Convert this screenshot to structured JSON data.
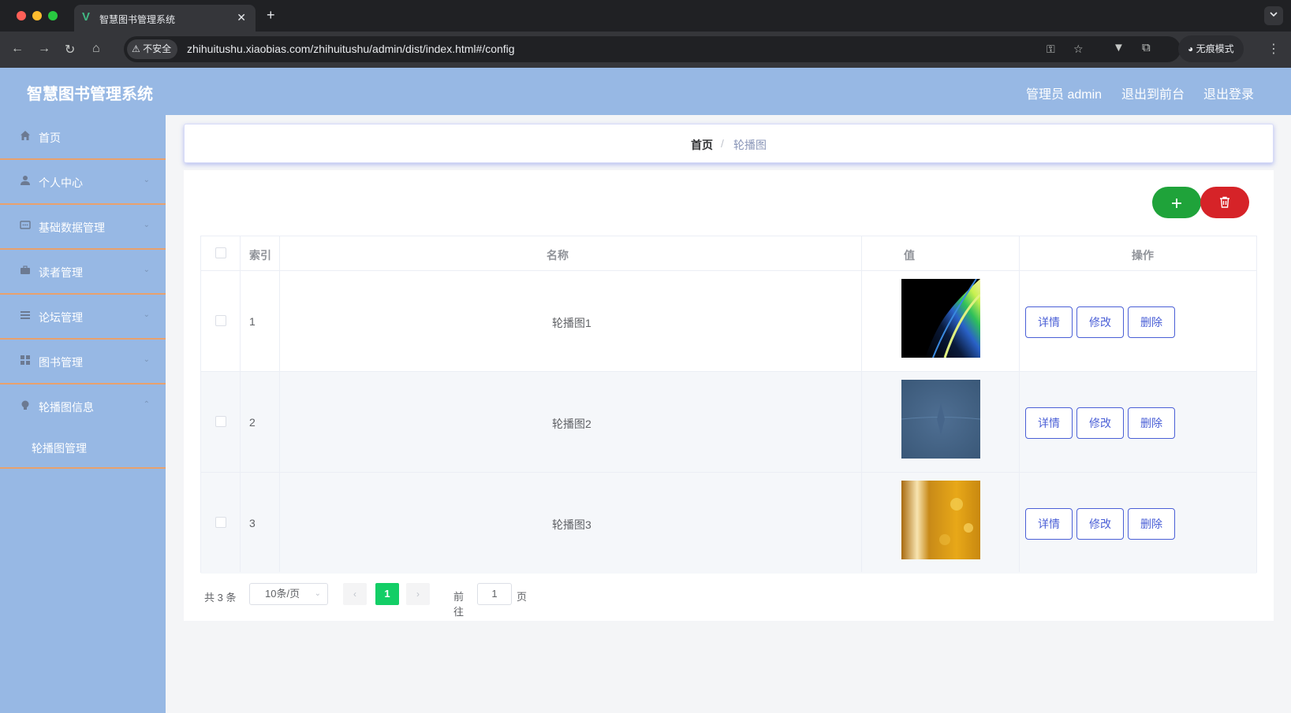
{
  "browser": {
    "tab_title": "智慧图书管理系统",
    "tab_icon": "vue-favicon-icon",
    "new_tab": "+",
    "close_tab": "✕",
    "security_label": "不安全",
    "url": "zhihuitushu.xiaobias.com/zhihuitushu/admin/dist/index.html#/config",
    "incognito_label": "无痕模式"
  },
  "header": {
    "title": "智慧图书管理系统",
    "user": "管理员 admin",
    "back_to_front": "退出到前台",
    "logout": "退出登录",
    "bg_color": "#97b8e4"
  },
  "sidebar": {
    "items": [
      {
        "label": "首页",
        "icon": "home-icon",
        "has_arrow": false
      },
      {
        "label": "个人中心",
        "icon": "user-icon",
        "has_arrow": true
      },
      {
        "label": "基础数据管理",
        "icon": "chat-icon",
        "has_arrow": true
      },
      {
        "label": "读者管理",
        "icon": "briefcase-icon",
        "has_arrow": true
      },
      {
        "label": "论坛管理",
        "icon": "menu-lines-icon",
        "has_arrow": true
      },
      {
        "label": "图书管理",
        "icon": "grid-icon",
        "has_arrow": true
      },
      {
        "label": "轮播图信息",
        "icon": "bulb-icon",
        "has_arrow": true
      }
    ],
    "submenu_label": "轮播图管理",
    "divider_color": "#e8a16d"
  },
  "breadcrumb": {
    "home": "首页",
    "separator": "/",
    "current": "轮播图"
  },
  "toolbar": {
    "add_icon": "plus-icon",
    "delete_icon": "trash-icon",
    "add_color": "#1fa33a",
    "delete_color": "#d62328"
  },
  "table": {
    "headers": {
      "index": "索引",
      "name": "名称",
      "value": "值",
      "actions": "操作"
    },
    "rows": [
      {
        "index": "1",
        "name": "轮播图1",
        "image": "abstract-green-wave-thumbnail"
      },
      {
        "index": "2",
        "name": "轮播图2",
        "image": "blue-texture-thumbnail"
      },
      {
        "index": "3",
        "name": "轮播图3",
        "image": "golden-bokeh-thumbnail"
      }
    ],
    "actions": {
      "detail": "详情",
      "edit": "修改",
      "delete": "删除"
    },
    "action_color": "#4a5fd6"
  },
  "pagination": {
    "total": "共 3 条",
    "page_size": "10条/页",
    "current_page": "1",
    "goto_label": "前往",
    "goto_value": "1",
    "page_suffix": "页",
    "active_color": "#13ce66"
  }
}
